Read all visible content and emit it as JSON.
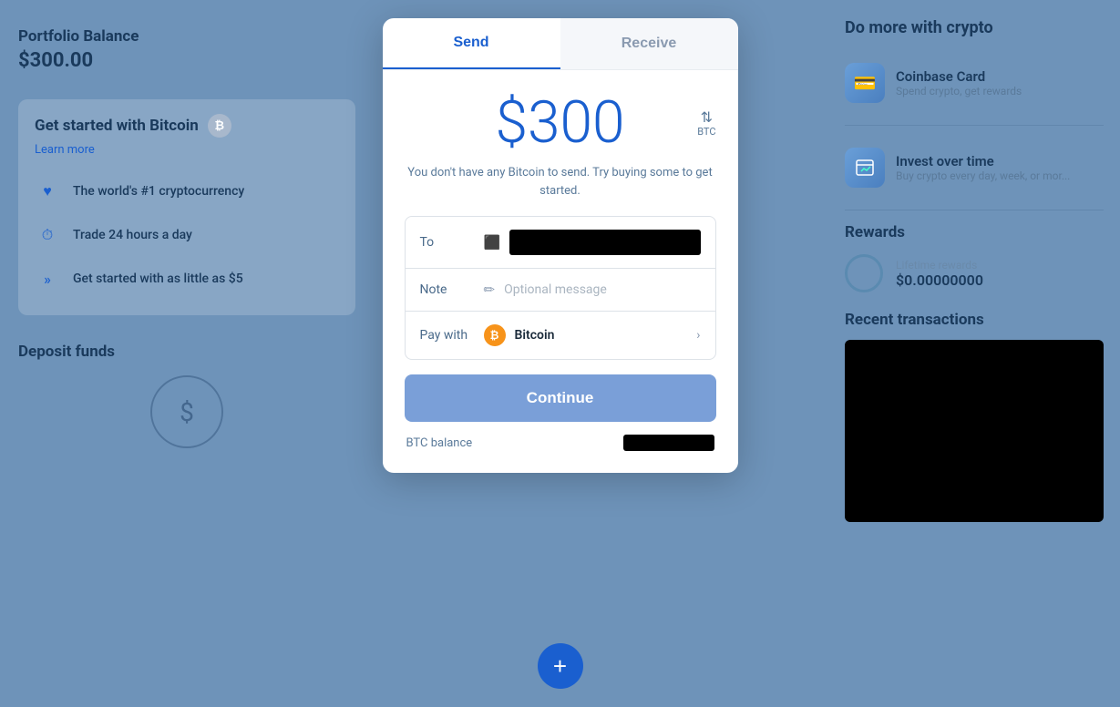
{
  "left": {
    "portfolio_label": "Portfolio Balance",
    "portfolio_value": "$300.00",
    "get_started_title": "Get started with Bitcoin",
    "learn_more": "Learn more",
    "features": [
      {
        "icon": "♥",
        "text": "The world's #1 cryptocurrency"
      },
      {
        "icon": "⏱",
        "text": "Trade 24 hours a day"
      },
      {
        "icon": "»",
        "text": "Get started with as little as $5"
      }
    ],
    "deposit_label": "Deposit funds"
  },
  "right": {
    "do_more_title": "Do more with crypto",
    "promo_cards": [
      {
        "icon": "💳",
        "title": "Coinbase Card",
        "desc": "Spend crypto, get rewards"
      },
      {
        "icon": "📅",
        "title": "Invest over time",
        "desc": "Buy crypto every day, week, or mor..."
      }
    ],
    "rewards_title": "Rewards",
    "lifetime_label": "Lifetime rewards",
    "lifetime_value": "$0.00000000",
    "recent_tx_title": "Recent transactions"
  },
  "modal": {
    "tab_send": "Send",
    "tab_receive": "Receive",
    "amount": "$300",
    "currency_label": "BTC",
    "warning": "You don't have any Bitcoin to send. Try buying some to get started.",
    "to_label": "To",
    "note_label": "Note",
    "note_placeholder": "Optional message",
    "pay_with_label": "Pay with",
    "bitcoin_name": "Bitcoin",
    "continue_label": "Continue",
    "btc_balance_label": "BTC balance"
  }
}
